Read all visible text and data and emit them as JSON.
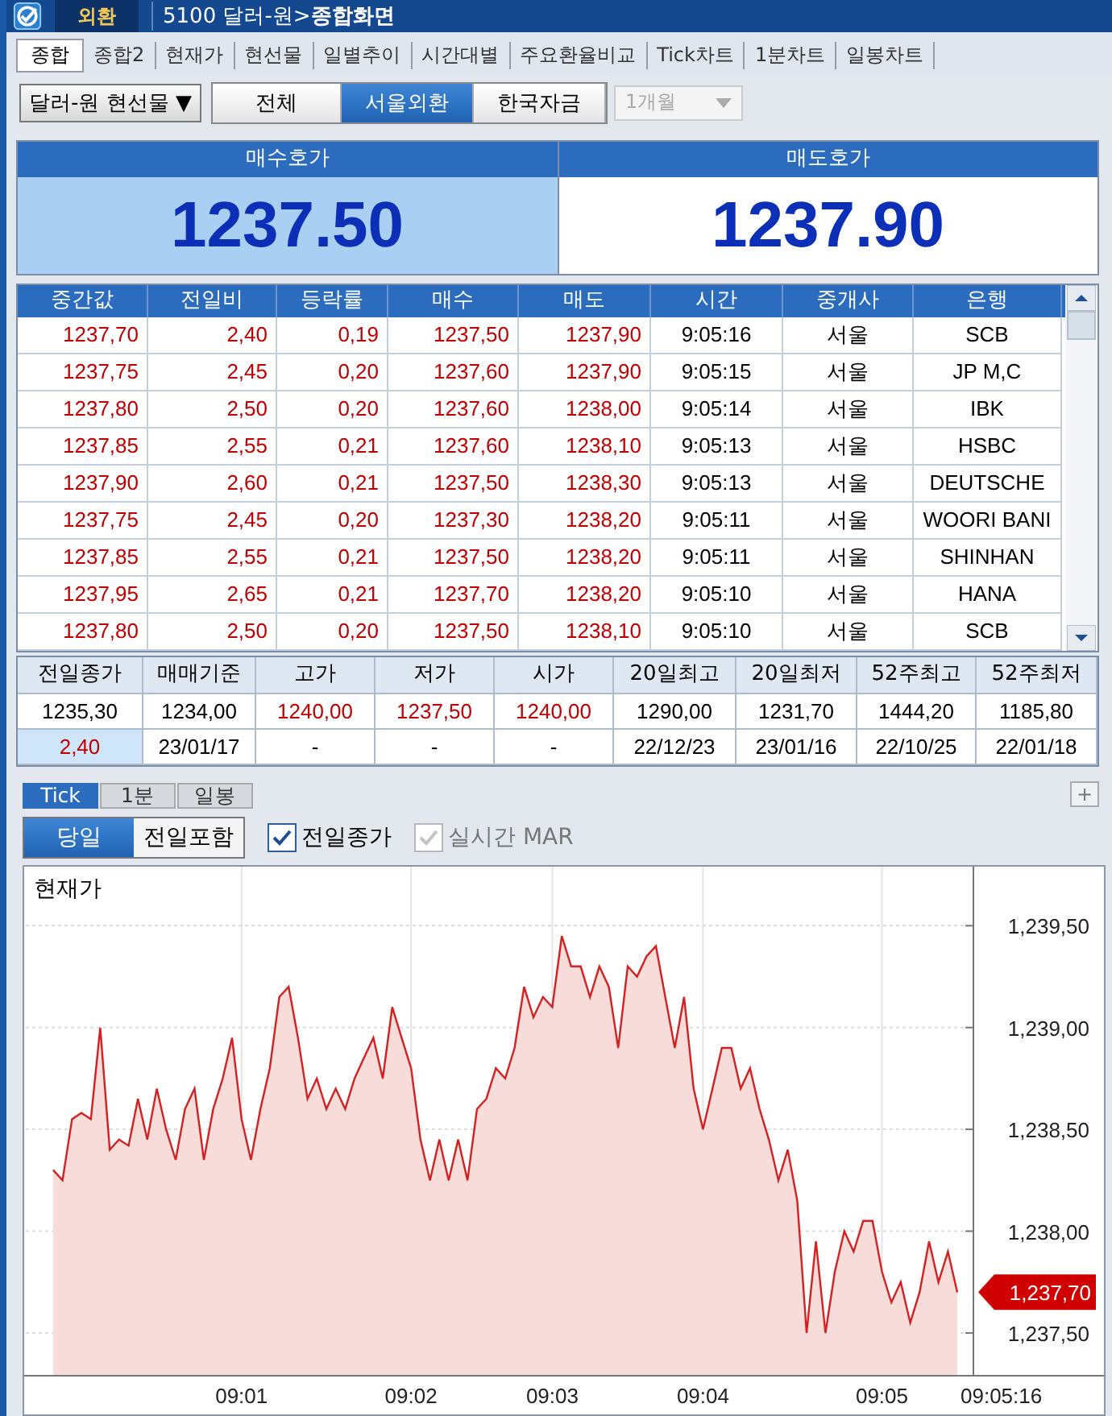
{
  "title_bar": {
    "badge": "외환",
    "title": "5100 달러-원>**종합화면**"
  },
  "tabs": [
    {
      "label": "종합",
      "selected": true
    },
    {
      "label": "종합2",
      "selected": false
    },
    {
      "label": "현재가",
      "selected": false
    },
    {
      "label": "현선물",
      "selected": false
    },
    {
      "label": "일별추이",
      "selected": false
    },
    {
      "label": "시간대별",
      "selected": false
    },
    {
      "label": "주요환율비교",
      "selected": false
    },
    {
      "label": "Tick차트",
      "selected": false
    },
    {
      "label": "1분차트",
      "selected": false
    },
    {
      "label": "일봉차트",
      "selected": false
    }
  ],
  "toolbar": {
    "instrument": "달러-원 현선물 ▼",
    "segments": [
      {
        "label": "전체",
        "selected": false
      },
      {
        "label": "서울외환",
        "selected": true
      },
      {
        "label": "한국자금",
        "selected": false
      }
    ],
    "period": {
      "value": "1개월",
      "disabled": true
    }
  },
  "quotes": [
    {
      "label": "매수호가",
      "value": "1237.50",
      "highlighted": true
    },
    {
      "label": "매도호가",
      "value": "1237.90",
      "highlighted": false
    }
  ],
  "ticks_table": {
    "columns": [
      "중간값",
      "전일비",
      "등락률",
      "매수",
      "매도",
      "시간",
      "중개사",
      "은행"
    ],
    "rows": [
      [
        "1237,70",
        "2,40",
        "0,19",
        "1237,50",
        "1237,90",
        "9:05:16",
        "서울",
        "SCB"
      ],
      [
        "1237,75",
        "2,45",
        "0,20",
        "1237,60",
        "1237,90",
        "9:05:15",
        "서울",
        "JP M,C"
      ],
      [
        "1237,80",
        "2,50",
        "0,20",
        "1237,60",
        "1238,00",
        "9:05:14",
        "서울",
        "IBK"
      ],
      [
        "1237,85",
        "2,55",
        "0,21",
        "1237,60",
        "1238,10",
        "9:05:13",
        "서울",
        "HSBC"
      ],
      [
        "1237,90",
        "2,60",
        "0,21",
        "1237,50",
        "1238,30",
        "9:05:13",
        "서울",
        "DEUTSCHE"
      ],
      [
        "1237,75",
        "2,45",
        "0,20",
        "1237,30",
        "1238,20",
        "9:05:11",
        "서울",
        "WOORI BANI"
      ],
      [
        "1237,85",
        "2,55",
        "0,21",
        "1237,50",
        "1238,20",
        "9:05:11",
        "서울",
        "SHINHAN"
      ],
      [
        "1237,95",
        "2,65",
        "0,21",
        "1237,70",
        "1238,20",
        "9:05:10",
        "서울",
        "HANA"
      ],
      [
        "1237,80",
        "2,50",
        "0,20",
        "1237,50",
        "1238,10",
        "9:05:10",
        "서울",
        "SCB"
      ]
    ]
  },
  "summary_table": {
    "columns": [
      "전일종가",
      "매매기준",
      "고가",
      "저가",
      "시가",
      "20일최고",
      "20일최저",
      "52주최고",
      "52주최저"
    ],
    "rows": [
      [
        {
          "text": "1235,30",
          "rising": false,
          "highlighted": false
        },
        {
          "text": "1234,00",
          "rising": false,
          "highlighted": false
        },
        {
          "text": "1240,00",
          "rising": true,
          "highlighted": false
        },
        {
          "text": "1237,50",
          "rising": true,
          "highlighted": false
        },
        {
          "text": "1240,00",
          "rising": true,
          "highlighted": false
        },
        {
          "text": "1290,00",
          "rising": false,
          "highlighted": false
        },
        {
          "text": "1231,70",
          "rising": false,
          "highlighted": false
        },
        {
          "text": "1444,20",
          "rising": false,
          "highlighted": false
        },
        {
          "text": "1185,80",
          "rising": false,
          "highlighted": false
        }
      ],
      [
        {
          "text": "2,40",
          "rising": true,
          "highlighted": true
        },
        {
          "text": "23/01/17",
          "rising": false,
          "highlighted": false
        },
        {
          "text": "-",
          "rising": false,
          "highlighted": false
        },
        {
          "text": "-",
          "rising": false,
          "highlighted": false
        },
        {
          "text": "-",
          "rising": false,
          "highlighted": false
        },
        {
          "text": "22/12/23",
          "rising": false,
          "highlighted": false
        },
        {
          "text": "23/01/16",
          "rising": false,
          "highlighted": false
        },
        {
          "text": "22/10/25",
          "rising": false,
          "highlighted": false
        },
        {
          "text": "22/01/18",
          "rising": false,
          "highlighted": false
        }
      ]
    ]
  },
  "chart_tabs": [
    {
      "label": "Tick",
      "selected": true
    },
    {
      "label": "1분",
      "selected": false
    },
    {
      "label": "일봉",
      "selected": false
    }
  ],
  "add_button": "+",
  "range_toggle": [
    {
      "label": "당일",
      "selected": true
    },
    {
      "label": "전일포함",
      "selected": false
    }
  ],
  "checkboxes": [
    {
      "label": "전일종가",
      "checked": true,
      "disabled": false
    },
    {
      "label": "실시간 MAR",
      "checked": true,
      "disabled": true
    }
  ],
  "chart": {
    "title": "현재가",
    "y_labels": [
      "1,239,50",
      "1,239,00",
      "1,238,50",
      "1,238,00",
      "1,237,50"
    ],
    "x_labels": [
      "09:01",
      "09:02",
      "09:03",
      "09:04",
      "09:05",
      "09:05:16"
    ],
    "price_marker": "1,237,70"
  }
}
